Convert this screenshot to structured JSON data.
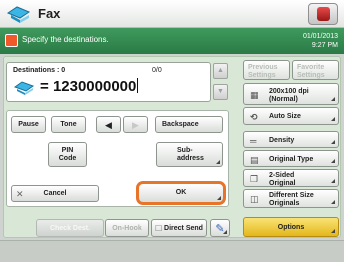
{
  "header": {
    "title": "Fax"
  },
  "message": {
    "text": "Specify the destinations.",
    "date": "01/01/2013",
    "time": "9:27 PM"
  },
  "destination": {
    "label": "Destinations : 0",
    "count": "0/0",
    "number": "1230000000"
  },
  "keypad": {
    "pause": "Pause",
    "tone": "Tone",
    "backspace": "Backspace",
    "pin_code": [
      "PIN",
      "Code"
    ],
    "sub_address": [
      "Sub-",
      "address"
    ],
    "cancel": "Cancel",
    "ok": "OK"
  },
  "footer": {
    "check_dest": "Check Dest.",
    "on_hook": "On-Hook",
    "direct_send": "Direct Send"
  },
  "settings": {
    "previous": [
      "Previous",
      "Settings"
    ],
    "favorite": [
      "Favorite",
      "Settings"
    ],
    "resolution": [
      "200x100 dpi",
      "(Normal)"
    ],
    "auto_size": "Auto Size",
    "density": "Density",
    "original_type": "Original Type",
    "two_sided": [
      "2-Sided",
      "Original"
    ],
    "diff_size": [
      "Different Size",
      "Originals"
    ],
    "options": "Options"
  },
  "colors": {
    "accent_green": "#2f8a4f",
    "ok_ring": "#e8742a",
    "options_yellow": "#f2c928"
  }
}
